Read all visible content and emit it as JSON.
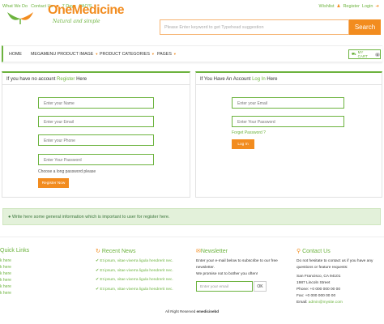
{
  "topbar": {
    "links": [
      "What We Do",
      "Contact Us",
      "7 Days",
      "FAQ'S"
    ],
    "wishlist": "Wishlist",
    "register": "Register",
    "login": "Login"
  },
  "logo": {
    "name": "OneMedicine",
    "tagline": "Natural and simple"
  },
  "search": {
    "placeholder": "Please Enter keyword to get Typehead suggestion",
    "button": "Search"
  },
  "nav": {
    "items": [
      "HOME",
      "MEGAMENU PRODUCT IMAGE",
      "PRODUCT CATEGORIES",
      "PAGES"
    ],
    "cart_label": "MY CART",
    "cart_count": "0"
  },
  "register_panel": {
    "heading_prefix": "If you have no account",
    "heading_link": "Register",
    "heading_suffix": "Here",
    "name_placeholder": "Enter your Name",
    "email_placeholder": "Enter your Email",
    "phone_placeholder": "Enter your Phone",
    "password_placeholder": "Enter Your Password",
    "hint": "Choose a long password please",
    "button": "Register Now"
  },
  "login_panel": {
    "heading_prefix": "If You Have An Account",
    "heading_link": "Log In",
    "heading_suffix": "Here",
    "email_placeholder": "Enter your Email",
    "password_placeholder": "Enter Your Password",
    "forgot": "Forget Password ?",
    "button": "Log In"
  },
  "note": "Write here some general information which is important to user for register here.",
  "footer": {
    "quick_title": "Quick Links",
    "quick_items": [
      "k here",
      "k here",
      "k here",
      "k here",
      "k here",
      "k here"
    ],
    "news_title": "Recent News",
    "news_items": [
      "Et ipsum, vitae viverra ligula hendrerit nec.",
      "Et ipsum, vitae viverra ligula hendrerit nec.",
      "Et ipsum, vitae viverra ligula hendrerit nec.",
      "Et ipsum, vitae viverra ligula hendrerit nec."
    ],
    "newsletter_title": "Newsletter",
    "newsletter_text": "Enter your e-mail below to subscribe to our free newsletter.",
    "newsletter_promise": "We promise not to bother you often!",
    "newsletter_placeholder": "Enter your email",
    "newsletter_button": "OK",
    "contact_title": "Contact Us",
    "contact_text": "Do not hesitate to contact us if you have any questions or feature requests:",
    "address1": "San Francisco, CA 94101",
    "address2": "1987 Lincoln Street",
    "phone": "Phone: +0 000 000 00 00",
    "fax": "Fax: +0 000 000 00 00",
    "email_label": "Email:",
    "email": "admin@mysite.com"
  },
  "copyright_prefix": "All Right Reserved",
  "copyright_brand": "emedicinebd",
  "colors": {
    "green": "#6cb33e",
    "orange": "#f28c1f"
  }
}
